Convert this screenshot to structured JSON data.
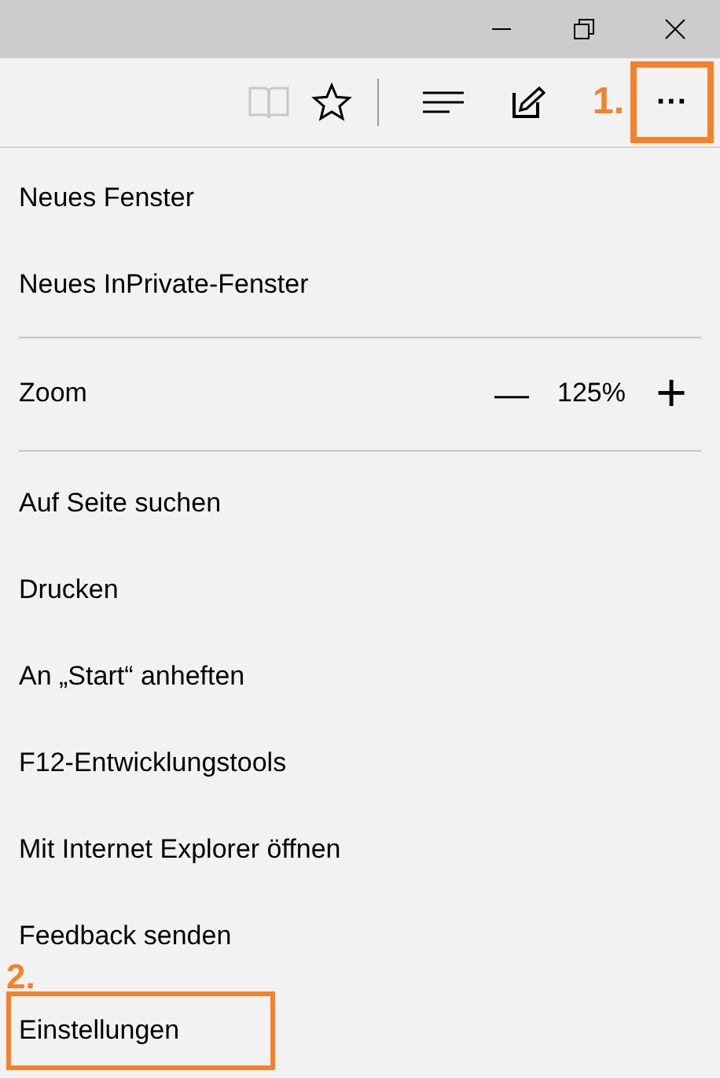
{
  "toolbar": {
    "reading_view_disabled": true,
    "more_button": {
      "label": "···",
      "annotation": "1."
    }
  },
  "menu": [
    {
      "kind": "item",
      "label": "Neues Fenster"
    },
    {
      "kind": "item",
      "label": "Neues InPrivate-Fenster"
    },
    {
      "kind": "divider"
    },
    {
      "kind": "zoom",
      "label": "Zoom",
      "minus": "—",
      "value": "125%",
      "plus": "+"
    },
    {
      "kind": "divider"
    },
    {
      "kind": "item",
      "label": "Auf Seite suchen"
    },
    {
      "kind": "item",
      "label": "Drucken"
    },
    {
      "kind": "item",
      "label": "An „Start“ anheften"
    },
    {
      "kind": "item",
      "label": "F12-Entwicklungstools"
    },
    {
      "kind": "item",
      "label": "Mit Internet Explorer öffnen"
    },
    {
      "kind": "item",
      "label": "Feedback senden"
    },
    {
      "kind": "item",
      "label": "Einstellungen",
      "annotation": "2."
    }
  ]
}
